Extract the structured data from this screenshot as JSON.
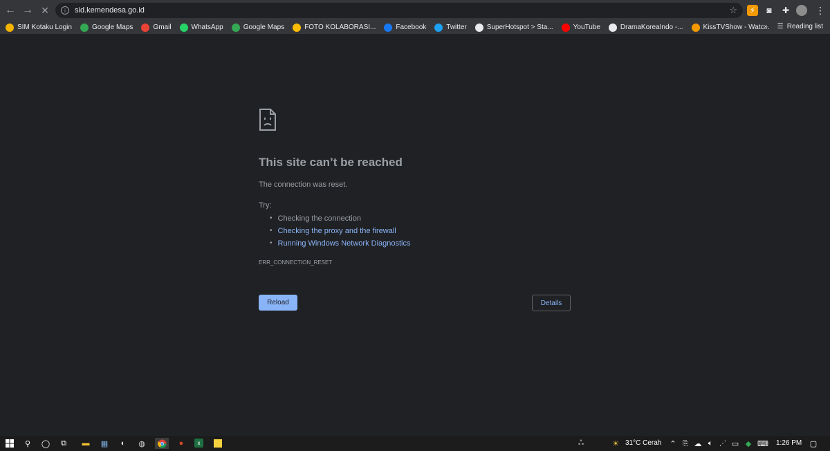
{
  "browser": {
    "url": "sid.kemendesa.go.id",
    "reading_list": "Reading list",
    "more": "»"
  },
  "bookmarks": [
    {
      "label": "SIM Kotaku Login",
      "icon": "kotaku-icon",
      "color": "#f4b400"
    },
    {
      "label": "Google Maps",
      "icon": "maps-icon",
      "color": "#34a853"
    },
    {
      "label": "Gmail",
      "icon": "gmail-icon",
      "color": "#ea4335"
    },
    {
      "label": "WhatsApp",
      "icon": "whatsapp-icon",
      "color": "#25d366"
    },
    {
      "label": "Google Maps",
      "icon": "maps-icon",
      "color": "#34a853"
    },
    {
      "label": "FOTO KOLABORASI...",
      "icon": "drive-icon",
      "color": "#fbbc04"
    },
    {
      "label": "Facebook",
      "icon": "facebook-icon",
      "color": "#1877f2"
    },
    {
      "label": "Twitter",
      "icon": "twitter-icon",
      "color": "#1da1f2"
    },
    {
      "label": "SuperHotspot > Sta...",
      "icon": "globe-icon",
      "color": "#e8eaed"
    },
    {
      "label": "YouTube",
      "icon": "youtube-icon",
      "color": "#ff0000"
    },
    {
      "label": "DramaKoreaIndo -...",
      "icon": "wordpress-icon",
      "color": "#e8eaed"
    },
    {
      "label": "KissTVShow - Watc...",
      "icon": "kisstv-icon",
      "color": "#f29900"
    }
  ],
  "error": {
    "title": "This site can’t be reached",
    "description": "The connection was reset.",
    "try_label": "Try:",
    "tips": [
      {
        "text": "Checking the connection",
        "link": false
      },
      {
        "text": "Checking the proxy and the firewall",
        "link": true
      },
      {
        "text": "Running Windows Network Diagnostics",
        "link": true
      }
    ],
    "code": "ERR_CONNECTION_RESET",
    "reload_label": "Reload",
    "details_label": "Details"
  },
  "taskbar": {
    "weather": "31°C  Cerah",
    "time": "1:26 PM"
  },
  "colors": {
    "background": "#202124",
    "toolbar": "#35363a",
    "link": "#8ab4f8",
    "text_muted": "#9aa0a6"
  }
}
